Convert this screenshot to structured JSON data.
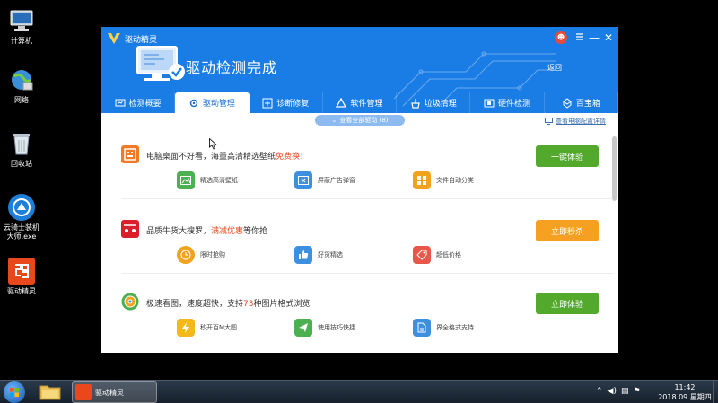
{
  "desktop": {
    "icons": [
      {
        "label": "计算机",
        "icon": "computer-icon"
      },
      {
        "label": "网络",
        "icon": "network-icon"
      },
      {
        "label": "回收站",
        "icon": "recycle-bin-icon"
      },
      {
        "label": "云骑士装机大师.exe",
        "icon": "yunqishi-icon"
      },
      {
        "label": "驱动精灵",
        "icon": "qudong-app-icon"
      }
    ]
  },
  "window": {
    "app_title": "驱动精灵",
    "status_title": "驱动检测完成",
    "back_link": "返回",
    "controls": {
      "minimize": "—",
      "close": "✕"
    },
    "tabs": [
      {
        "label": "检测概要"
      },
      {
        "label": "驱动管理"
      },
      {
        "label": "诊断修复"
      },
      {
        "label": "软件管理"
      },
      {
        "label": "垃圾清理"
      },
      {
        "label": "硬件检测"
      },
      {
        "label": "百宝箱"
      }
    ],
    "active_tab": "驱动管理",
    "view_all": "查看全部驱动 (8)",
    "hw_link": "查看电脑配置详情",
    "promos": [
      {
        "head_pre": "电脑桌面不好看，海量高清精选壁纸",
        "head_em": "免费换",
        "head_post": "！",
        "cta": "一键体验",
        "features": [
          "精选高清壁纸",
          "屏蔽广告弹窗",
          "文件自动分类"
        ]
      },
      {
        "head_pre": "品质牛货大搜罗，",
        "head_em": "满减优惠",
        "head_post": "等你抢",
        "cta": "立即秒杀",
        "features": [
          "限时抢购",
          "好货精选",
          "超低价格"
        ]
      },
      {
        "head_pre": "极速看图，速度超快，支持",
        "head_em": "73",
        "head_post": "种图片格式浏览",
        "cta": "立即体验",
        "features": [
          "秒开百M大图",
          "使用技巧快捷",
          "界全格式支持"
        ]
      }
    ],
    "colors": {
      "header": "#1a7de6",
      "green_cta": "#52a92b",
      "orange_cta": "#f5a021",
      "accent_red": "#e8481c"
    }
  },
  "taskbar": {
    "task_label": "驱动精灵",
    "time": "11:42",
    "date": "2018.09.星期四"
  }
}
